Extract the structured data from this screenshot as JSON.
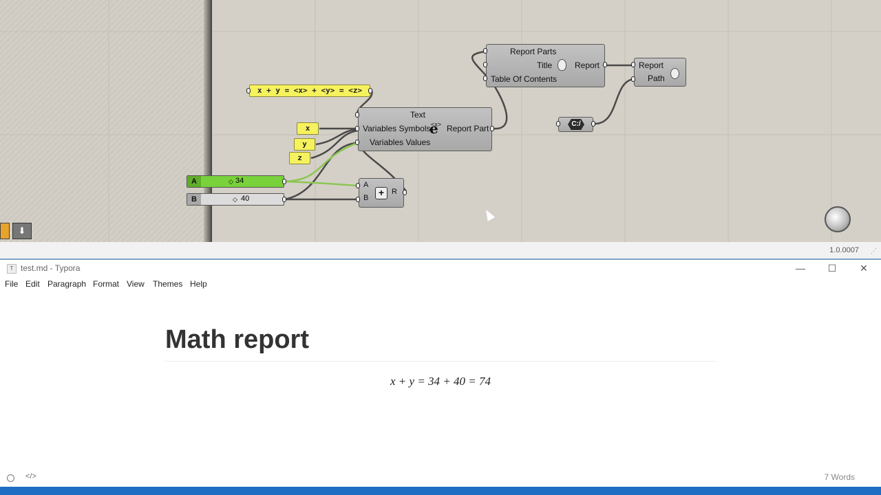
{
  "canvas": {
    "formula_panel": "x + y = <x> + <y> = <z>",
    "panel_x": "x",
    "panel_y": "y",
    "panel_z": "z",
    "slider_a": {
      "tag": "A",
      "value": "34",
      "level": 0.34
    },
    "slider_b": {
      "tag": "B",
      "value": "40",
      "level": 0.4
    },
    "report_part_node": {
      "input_text": "Text",
      "input_symbols": "Variables Symbols",
      "input_values": "Variables Values",
      "output": "Report Part",
      "icon_glyph": "e",
      "icon_super": "<x>"
    },
    "report_node": {
      "input_parts": "Report Parts",
      "input_title": "Title",
      "input_toc": "Table Of Contents",
      "output": "Report"
    },
    "save_node": {
      "input_report": "Report",
      "input_path": "Path"
    },
    "path_param": "C:/",
    "addition_node": {
      "input_a": "A",
      "input_b": "B",
      "output": "R",
      "icon_glyph": "+"
    },
    "version": "1.0.0007",
    "colors": {
      "panel_yellow": "#f6f25d",
      "slider_green": "#79d13b",
      "wire_green": "#8dc653"
    }
  },
  "window": {
    "icon_glyph": "T",
    "title": "test.md - Typora",
    "minimize": "—",
    "maximize": "☐",
    "close": "✕"
  },
  "menu": [
    "File",
    "Edit",
    "Paragraph",
    "Format",
    "View",
    "Themes",
    "Help"
  ],
  "document": {
    "heading": "Math report",
    "equation": "x + y = 34 + 40 = 74"
  },
  "status": {
    "word_count": "7 Words",
    "left_icons": [
      "circle-icon",
      "code-icon"
    ]
  }
}
